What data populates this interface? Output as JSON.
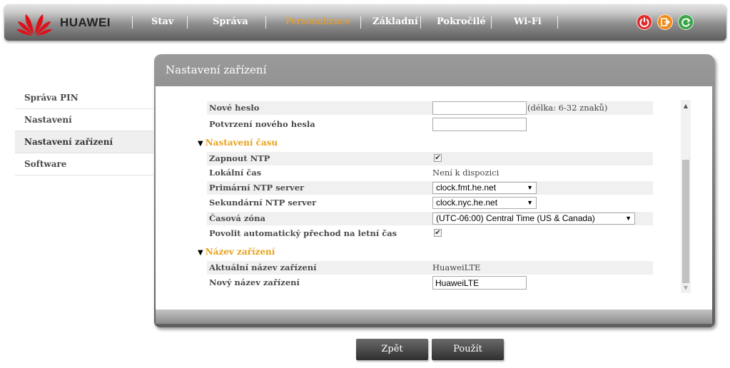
{
  "brand": {
    "name": "HUAWEI"
  },
  "nav": {
    "items": [
      {
        "label": "Stav"
      },
      {
        "label": "Správa"
      },
      {
        "label": "Personalizace"
      },
      {
        "label": "Základní"
      },
      {
        "label": "Pokročilé"
      },
      {
        "label": "Wi-Fi"
      }
    ],
    "active": "Personalizace"
  },
  "top_icons": [
    "power-icon",
    "logout-icon",
    "refresh-icon"
  ],
  "sidebar": {
    "items": [
      {
        "label": "Správa PIN"
      },
      {
        "label": "Nastavení"
      },
      {
        "label": "Nastavení zařízení"
      },
      {
        "label": "Software"
      }
    ],
    "active": "Nastavení zařízení"
  },
  "panel": {
    "title": "Nastavení zařízení",
    "password": {
      "new_label": "Nové heslo",
      "new_value": "",
      "new_hint": "(délka: 6-32 znaků)",
      "confirm_label": "Potvrzení nového hesla",
      "confirm_value": ""
    },
    "time": {
      "section_title": "Nastavení času",
      "ntp_label": "Zapnout NTP",
      "ntp_checked": true,
      "local_time_label": "Lokální čas",
      "local_time_value": "Není k dispozici",
      "primary_label": "Primární NTP server",
      "primary_value": "clock.fmt.he.net",
      "secondary_label": "Sekundární NTP server",
      "secondary_value": "clock.nyc.he.net",
      "zone_label": "Časová zóna",
      "zone_value": "(UTC-06:00) Central Time (US & Canada)",
      "dst_label": "Povolit automatický přechod na letní čas",
      "dst_checked": true
    },
    "device_name": {
      "section_title": "Název zařízení",
      "current_label": "Aktuální název zařízení",
      "current_value": "HuaweiLTE",
      "new_label": "Nový název zařízení",
      "new_value": "HuaweiLTE"
    }
  },
  "buttons": {
    "back": "Zpět",
    "apply": "Použít"
  },
  "colors": {
    "accent": "#e8a21a",
    "nav_active": "#f0a020"
  }
}
